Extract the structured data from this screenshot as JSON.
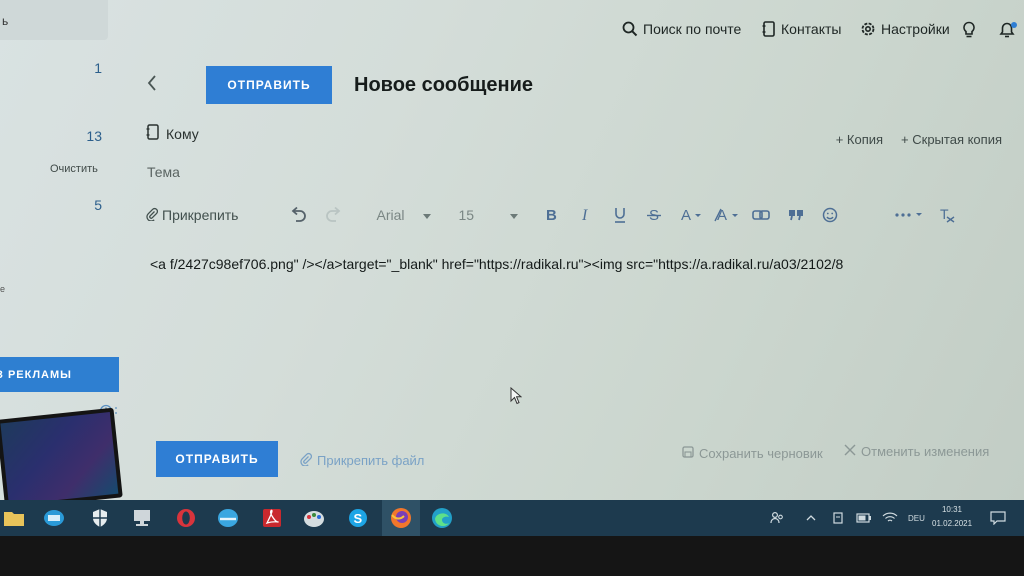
{
  "header": {
    "left_stub": "ь",
    "search_label": "Поиск по почте",
    "contacts_label": "Контакты",
    "settings_label": "Настройки"
  },
  "sidebar": {
    "counts": [
      "1",
      "13",
      "5"
    ],
    "clear_label": "Очистить",
    "edge_letter": "е",
    "ad_button_label": "З РЕКЛАМЫ"
  },
  "compose": {
    "title": "Новое сообщение",
    "send_label": "ОТПРАВИТЬ",
    "to_label": "Кому",
    "cc_label": "+ Копия",
    "bcc_label": "+ Скрытая копия",
    "subject_placeholder": "Тема",
    "body_text": "<a f/2427c98ef706.png\" /></a>target=\"_blank\" href=\"https://radikal.ru\"><img src=\"https://a.radikal.ru/a03/2102/8",
    "toolbar": {
      "attach_label": "Прикрепить",
      "font_family": "Arial",
      "font_size": "15"
    },
    "footer": {
      "send_label": "ОТПРАВИТЬ",
      "attach_file_label": "Прикрепить файл",
      "save_draft_label": "Сохранить черновик",
      "cancel_label": "Отменить изменения"
    }
  },
  "taskbar": {
    "language": "DEU",
    "time": "10:31",
    "date": "01.02.2021"
  },
  "colors": {
    "accent": "#2f7ed4",
    "taskbar": "#1d3a4e"
  }
}
